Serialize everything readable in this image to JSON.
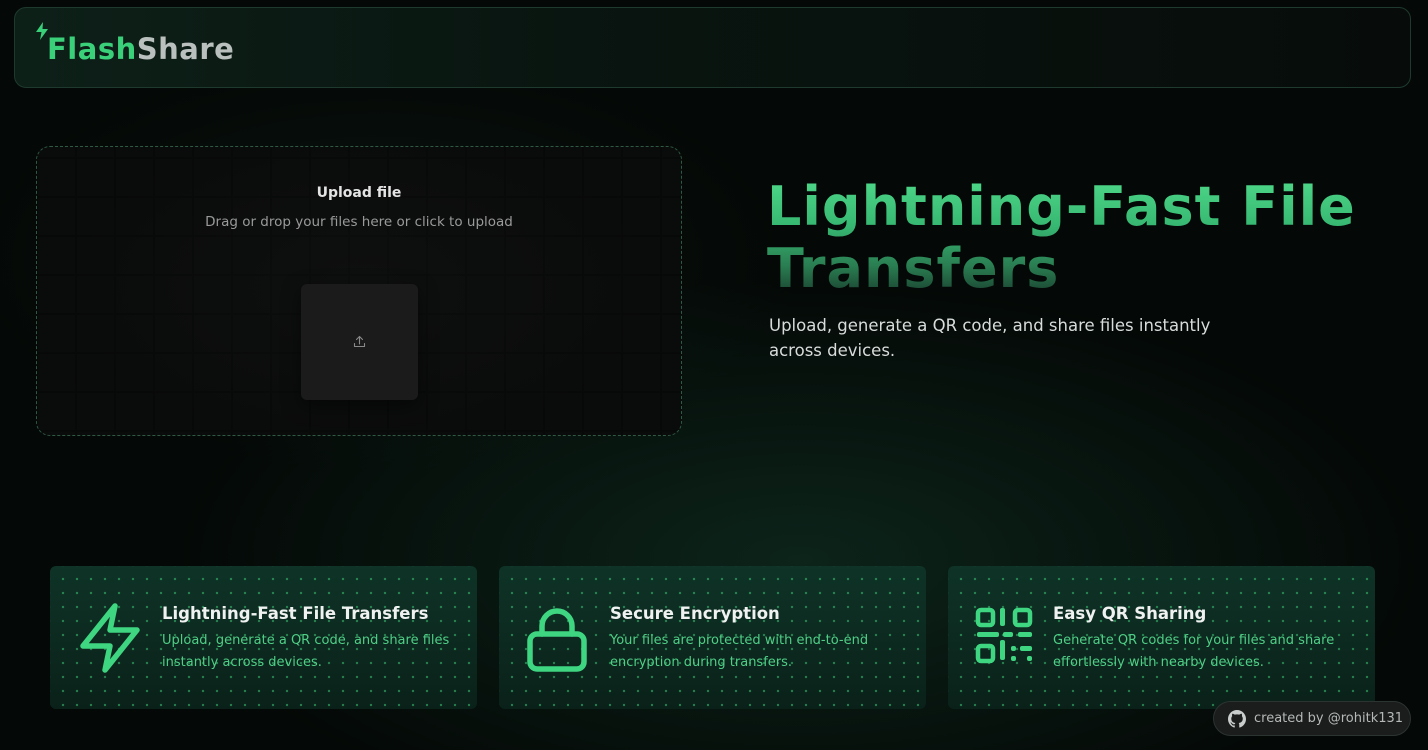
{
  "brand": {
    "name_part1": "Flash",
    "name_part2": "Share",
    "icon": "lightning-bolt-icon",
    "accent_color": "#3ad07a"
  },
  "upload": {
    "title": "Upload file",
    "subtitle": "Drag or drop your files here or click to upload",
    "icon": "upload-icon"
  },
  "hero": {
    "title": "Lightning-Fast File Transfers",
    "subtitle": "Upload, generate a QR code, and share files instantly across devices."
  },
  "features": [
    {
      "icon": "lightning-bolt-icon",
      "title": "Lightning-Fast File Transfers",
      "description": "Upload, generate a QR code, and share files instantly across devices."
    },
    {
      "icon": "lock-icon",
      "title": "Secure Encryption",
      "description": "Your files are protected with end-to-end encryption during transfers."
    },
    {
      "icon": "qr-code-icon",
      "title": "Easy QR Sharing",
      "description": "Generate QR codes for your files and share effortlessly with nearby devices."
    }
  ],
  "credit": {
    "icon": "github-icon",
    "text": "created by @rohitk131"
  }
}
